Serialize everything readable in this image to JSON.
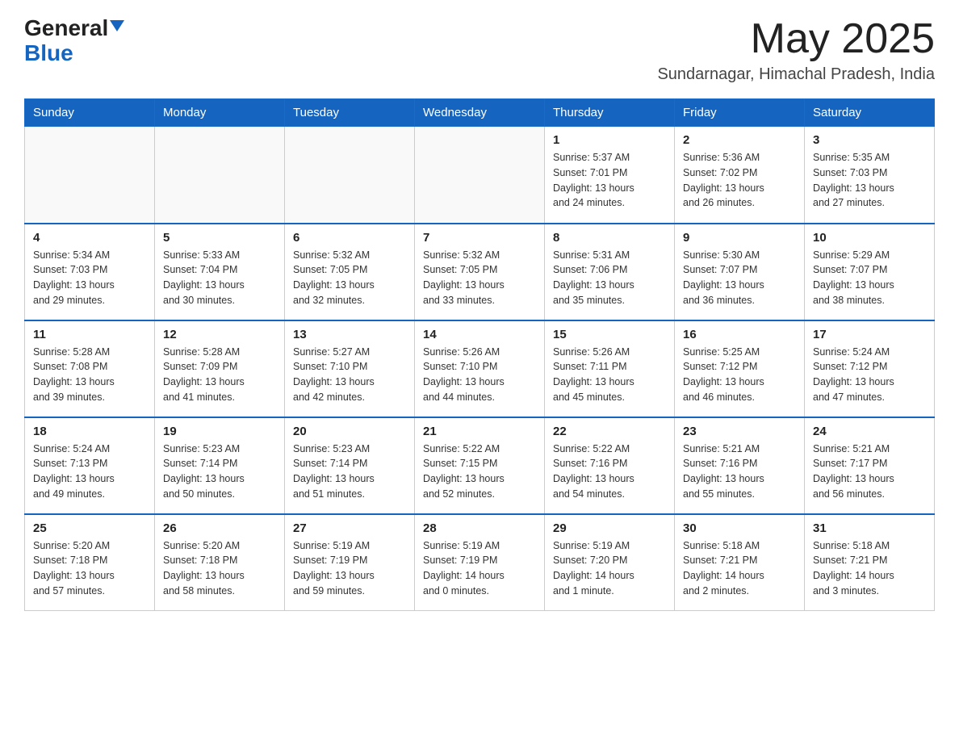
{
  "header": {
    "logo_general": "General",
    "logo_blue": "Blue",
    "month_year": "May 2025",
    "location": "Sundarnagar, Himachal Pradesh, India"
  },
  "days_of_week": [
    "Sunday",
    "Monday",
    "Tuesday",
    "Wednesday",
    "Thursday",
    "Friday",
    "Saturday"
  ],
  "weeks": [
    {
      "days": [
        {
          "number": "",
          "info": ""
        },
        {
          "number": "",
          "info": ""
        },
        {
          "number": "",
          "info": ""
        },
        {
          "number": "",
          "info": ""
        },
        {
          "number": "1",
          "info": "Sunrise: 5:37 AM\nSunset: 7:01 PM\nDaylight: 13 hours\nand 24 minutes."
        },
        {
          "number": "2",
          "info": "Sunrise: 5:36 AM\nSunset: 7:02 PM\nDaylight: 13 hours\nand 26 minutes."
        },
        {
          "number": "3",
          "info": "Sunrise: 5:35 AM\nSunset: 7:03 PM\nDaylight: 13 hours\nand 27 minutes."
        }
      ]
    },
    {
      "days": [
        {
          "number": "4",
          "info": "Sunrise: 5:34 AM\nSunset: 7:03 PM\nDaylight: 13 hours\nand 29 minutes."
        },
        {
          "number": "5",
          "info": "Sunrise: 5:33 AM\nSunset: 7:04 PM\nDaylight: 13 hours\nand 30 minutes."
        },
        {
          "number": "6",
          "info": "Sunrise: 5:32 AM\nSunset: 7:05 PM\nDaylight: 13 hours\nand 32 minutes."
        },
        {
          "number": "7",
          "info": "Sunrise: 5:32 AM\nSunset: 7:05 PM\nDaylight: 13 hours\nand 33 minutes."
        },
        {
          "number": "8",
          "info": "Sunrise: 5:31 AM\nSunset: 7:06 PM\nDaylight: 13 hours\nand 35 minutes."
        },
        {
          "number": "9",
          "info": "Sunrise: 5:30 AM\nSunset: 7:07 PM\nDaylight: 13 hours\nand 36 minutes."
        },
        {
          "number": "10",
          "info": "Sunrise: 5:29 AM\nSunset: 7:07 PM\nDaylight: 13 hours\nand 38 minutes."
        }
      ]
    },
    {
      "days": [
        {
          "number": "11",
          "info": "Sunrise: 5:28 AM\nSunset: 7:08 PM\nDaylight: 13 hours\nand 39 minutes."
        },
        {
          "number": "12",
          "info": "Sunrise: 5:28 AM\nSunset: 7:09 PM\nDaylight: 13 hours\nand 41 minutes."
        },
        {
          "number": "13",
          "info": "Sunrise: 5:27 AM\nSunset: 7:10 PM\nDaylight: 13 hours\nand 42 minutes."
        },
        {
          "number": "14",
          "info": "Sunrise: 5:26 AM\nSunset: 7:10 PM\nDaylight: 13 hours\nand 44 minutes."
        },
        {
          "number": "15",
          "info": "Sunrise: 5:26 AM\nSunset: 7:11 PM\nDaylight: 13 hours\nand 45 minutes."
        },
        {
          "number": "16",
          "info": "Sunrise: 5:25 AM\nSunset: 7:12 PM\nDaylight: 13 hours\nand 46 minutes."
        },
        {
          "number": "17",
          "info": "Sunrise: 5:24 AM\nSunset: 7:12 PM\nDaylight: 13 hours\nand 47 minutes."
        }
      ]
    },
    {
      "days": [
        {
          "number": "18",
          "info": "Sunrise: 5:24 AM\nSunset: 7:13 PM\nDaylight: 13 hours\nand 49 minutes."
        },
        {
          "number": "19",
          "info": "Sunrise: 5:23 AM\nSunset: 7:14 PM\nDaylight: 13 hours\nand 50 minutes."
        },
        {
          "number": "20",
          "info": "Sunrise: 5:23 AM\nSunset: 7:14 PM\nDaylight: 13 hours\nand 51 minutes."
        },
        {
          "number": "21",
          "info": "Sunrise: 5:22 AM\nSunset: 7:15 PM\nDaylight: 13 hours\nand 52 minutes."
        },
        {
          "number": "22",
          "info": "Sunrise: 5:22 AM\nSunset: 7:16 PM\nDaylight: 13 hours\nand 54 minutes."
        },
        {
          "number": "23",
          "info": "Sunrise: 5:21 AM\nSunset: 7:16 PM\nDaylight: 13 hours\nand 55 minutes."
        },
        {
          "number": "24",
          "info": "Sunrise: 5:21 AM\nSunset: 7:17 PM\nDaylight: 13 hours\nand 56 minutes."
        }
      ]
    },
    {
      "days": [
        {
          "number": "25",
          "info": "Sunrise: 5:20 AM\nSunset: 7:18 PM\nDaylight: 13 hours\nand 57 minutes."
        },
        {
          "number": "26",
          "info": "Sunrise: 5:20 AM\nSunset: 7:18 PM\nDaylight: 13 hours\nand 58 minutes."
        },
        {
          "number": "27",
          "info": "Sunrise: 5:19 AM\nSunset: 7:19 PM\nDaylight: 13 hours\nand 59 minutes."
        },
        {
          "number": "28",
          "info": "Sunrise: 5:19 AM\nSunset: 7:19 PM\nDaylight: 14 hours\nand 0 minutes."
        },
        {
          "number": "29",
          "info": "Sunrise: 5:19 AM\nSunset: 7:20 PM\nDaylight: 14 hours\nand 1 minute."
        },
        {
          "number": "30",
          "info": "Sunrise: 5:18 AM\nSunset: 7:21 PM\nDaylight: 14 hours\nand 2 minutes."
        },
        {
          "number": "31",
          "info": "Sunrise: 5:18 AM\nSunset: 7:21 PM\nDaylight: 14 hours\nand 3 minutes."
        }
      ]
    }
  ]
}
